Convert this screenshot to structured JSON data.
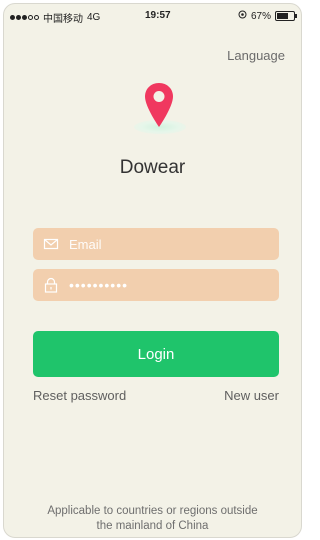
{
  "status_bar": {
    "carrier": "中国移动",
    "network": "4G",
    "time": "19:57",
    "battery_percent": "67%",
    "battery_level": 0.67,
    "signal_bars_filled": 3,
    "signal_bars_total": 5
  },
  "header": {
    "language_label": "Language"
  },
  "app": {
    "name": "Dowear",
    "pin_color": "#f0385f"
  },
  "form": {
    "email_placeholder": "Email",
    "password_value": "••••••••••",
    "login_label": "Login",
    "field_color": "#f2cfae",
    "login_color": "#1fc46b"
  },
  "links": {
    "reset_password": "Reset password",
    "new_user": "New user"
  },
  "footer": {
    "line1": "Applicable to countries or regions outside",
    "line2": "the mainland of China"
  },
  "icons": {
    "email": "envelope-icon",
    "password": "lock-icon",
    "logo": "map-pin-icon"
  }
}
